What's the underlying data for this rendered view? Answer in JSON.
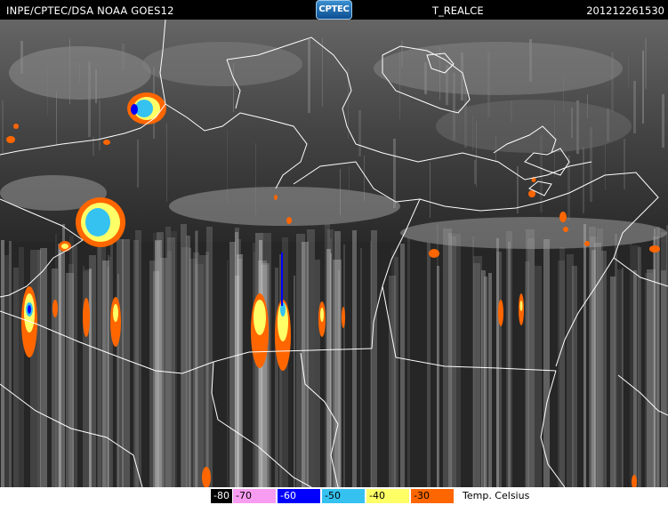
{
  "header": {
    "left_text": "INPE/CPTEC/DSA NOAA GOES12",
    "center_text": "T_REALCE",
    "right_text": "201212261530",
    "logo_text": "CPTEC"
  },
  "legend": {
    "unit_label": "Temp. Celsius",
    "items": [
      {
        "label": "-80",
        "color": "#000000",
        "text_color": "#ffffff"
      },
      {
        "label": "-70",
        "color": "#f79cf0",
        "text_color": "#000000"
      },
      {
        "label": "-60",
        "color": "#0000ff",
        "text_color": "#ffffff"
      },
      {
        "label": "-50",
        "color": "#35c2f1",
        "text_color": "#000000"
      },
      {
        "label": "-40",
        "color": "#ffff66",
        "text_color": "#000000"
      },
      {
        "label": "-30",
        "color": "#ff6600",
        "text_color": "#000000"
      }
    ]
  },
  "colors": {
    "background": "#262626",
    "cloud_gray": "#9a9a9a",
    "border_line": "#ffffff"
  }
}
